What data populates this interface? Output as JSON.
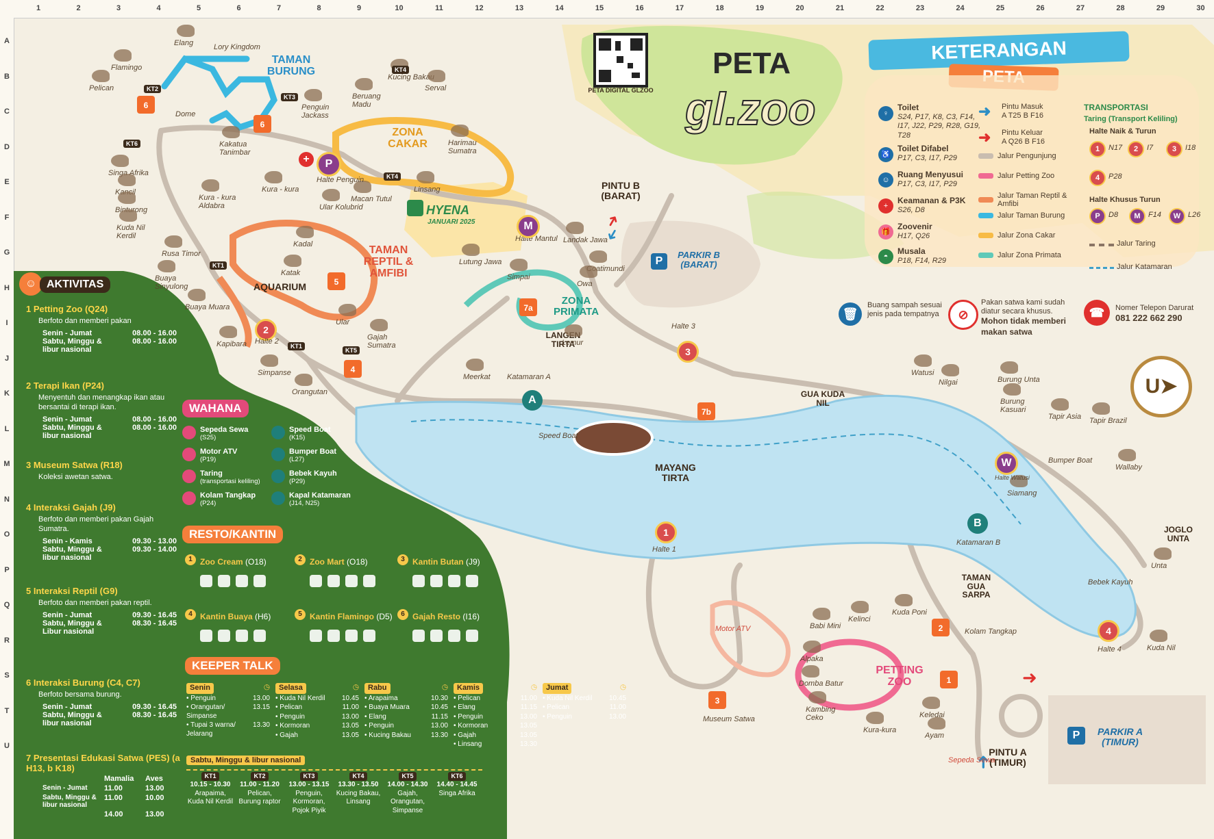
{
  "grid": {
    "columns": [
      "1",
      "2",
      "3",
      "4",
      "5",
      "6",
      "7",
      "8",
      "9",
      "10",
      "11",
      "12",
      "13",
      "14",
      "15",
      "16",
      "17",
      "18",
      "19",
      "20",
      "21",
      "22",
      "23",
      "24",
      "25",
      "26",
      "27",
      "28",
      "29",
      "30"
    ],
    "rows": [
      "A",
      "B",
      "C",
      "D",
      "E",
      "F",
      "G",
      "H",
      "I",
      "J",
      "K",
      "L",
      "M",
      "N",
      "O",
      "P",
      "Q",
      "R",
      "S",
      "T",
      "U"
    ]
  },
  "header": {
    "title_peta": "PETA",
    "logo_text": "gl.zoo",
    "qr_caption": "PETA DIGITAL GLZOO",
    "legend_title_1": "KETERANGAN",
    "legend_title_2": "PETA"
  },
  "legend": {
    "toilet": {
      "title": "Toilet",
      "codes": "S24, P17, K8, C3, F14, I17, J22, P29, R28, G19, T28"
    },
    "toilet_difabel": {
      "title": "Toilet Difabel",
      "codes": "P17, C3, I17, P29"
    },
    "ruang_menyusui": {
      "title": "Ruang Menyusui",
      "codes": "P17, C3, I17, P29"
    },
    "keamanan": {
      "title": "Keamanan & P3K",
      "codes": "S26, D8"
    },
    "zoovenir": {
      "title": "Zoovenir",
      "codes": "H17, Q26"
    },
    "musala": {
      "title": "Musala",
      "codes": "P18, F14, R29"
    },
    "pintu_masuk": {
      "title": "Pintu Masuk",
      "codes": "A T25   B F16"
    },
    "pintu_keluar": {
      "title": "Pintu Keluar",
      "codes": "A Q26   B F16"
    },
    "jalur": [
      "Jalur Pengunjung",
      "Jalur Petting Zoo",
      "Jalur Taman Reptil & Amfibi",
      "Jalur Taman Burung",
      "Jalur Zona Cakar",
      "Jalur Zona Primata"
    ],
    "jalur_colors": [
      "#c9bdb0",
      "#f06a92",
      "#f08a55",
      "#3bb8e0",
      "#f7bb45",
      "#5fc9b8"
    ],
    "transport_title": "TRANSPORTASI",
    "transport_sub": "Taring (Transport Keliling)",
    "halte_naik_turun": "Halte Naik & Turun",
    "halte_naik_list": [
      {
        "n": "1",
        "code": "N17"
      },
      {
        "n": "2",
        "code": "I7"
      },
      {
        "n": "3",
        "code": "I18"
      },
      {
        "n": "4",
        "code": "P28"
      }
    ],
    "halte_khusus_turun": "Halte Khusus Turun",
    "halte_turun_list": [
      {
        "n": "P",
        "code": "D8"
      },
      {
        "n": "M",
        "code": "F14"
      },
      {
        "n": "W",
        "code": "L26"
      }
    ],
    "jalur_taring": "Jalur Taring",
    "jalur_katamaran": "Jalur Katamaran",
    "buang_sampah": "Buang sampah sesuai jenis pada tempatnya",
    "pakan_1": "Pakan satwa kami sudah diatur secara khusus.",
    "pakan_2": "Mohon tidak memberi makan satwa",
    "telepon_label": "Nomer Telepon Darurat",
    "telepon": "081 222 662 290"
  },
  "map": {
    "zones": {
      "taman_burung": "TAMAN BURUNG",
      "zona_cakar": "ZONA CAKAR",
      "taman_reptil": "TAMAN REPTIL & AMFIBI",
      "aquarium": "AQUARIUM",
      "zona_primata": "ZONA PRIMATA",
      "langen_tirta": "LANGEN TIRTA",
      "mayang_tirta": "MAYANG TIRTA",
      "gua_kuda_nil": "GUA KUDA NIL",
      "taman_gua_sarpa": "TAMAN GUA SARPA",
      "petting_zoo": "PETTING ZOO",
      "joglo_unta": "JOGLO UNTA",
      "hyena": "HYENA",
      "hyena_date": "JANUARI 2025",
      "pintu_b": "PINTU B (BARAT)",
      "pintu_a": "PINTU A (TIMUR)",
      "parkir_b": "PARKIR B (BARAT)",
      "parkir_a": "PARKIR A (TIMUR)",
      "lory_kingdom": "Lory Kingdom",
      "dome": "Dome"
    },
    "animals": [
      {
        "name": "Elang"
      },
      {
        "name": "Flamingo"
      },
      {
        "name": "Pelican"
      },
      {
        "name": "Penguin Jackass"
      },
      {
        "name": "Beruang Madu"
      },
      {
        "name": "Kucing Bakau"
      },
      {
        "name": "Serval"
      },
      {
        "name": "Harimau Sumatra"
      },
      {
        "name": "Linsang"
      },
      {
        "name": "Macan Tutul"
      },
      {
        "name": "Kakatua Tanimbar"
      },
      {
        "name": "Singa Afrika"
      },
      {
        "name": "Kancil"
      },
      {
        "name": "Binturong"
      },
      {
        "name": "Kuda Nil Kerdil"
      },
      {
        "name": "Rusa Timor"
      },
      {
        "name": "Buaya Sinyulong"
      },
      {
        "name": "Buaya Muara"
      },
      {
        "name": "Kapibara"
      },
      {
        "name": "Simpanse"
      },
      {
        "name": "Orangutan"
      },
      {
        "name": "Gajah Sumatra"
      },
      {
        "name": "Kura - kura Aldabra"
      },
      {
        "name": "Kura - kura"
      },
      {
        "name": "Ular Kolubrid"
      },
      {
        "name": "Kadal"
      },
      {
        "name": "Katak"
      },
      {
        "name": "Ular"
      },
      {
        "name": "Lutung Jawa"
      },
      {
        "name": "Simpai"
      },
      {
        "name": "Landak Jawa"
      },
      {
        "name": "Coatimundi"
      },
      {
        "name": "Owa"
      },
      {
        "name": "Lemur"
      },
      {
        "name": "Meerkat"
      },
      {
        "name": "Watusi"
      },
      {
        "name": "Nilgai"
      },
      {
        "name": "Burung Unta"
      },
      {
        "name": "Burung Kasuari"
      },
      {
        "name": "Tapir Asia"
      },
      {
        "name": "Tapir Brazil"
      },
      {
        "name": "Wallaby"
      },
      {
        "name": "Siamang"
      },
      {
        "name": "Unta"
      },
      {
        "name": "Kuda Nil"
      },
      {
        "name": "Kelinci"
      },
      {
        "name": "Kuda Poni"
      },
      {
        "name": "Babi Mini"
      },
      {
        "name": "Alpaka"
      },
      {
        "name": "Domba Batur"
      },
      {
        "name": "Kambing Ceko"
      },
      {
        "name": "Kura-kura"
      },
      {
        "name": "Keledai"
      },
      {
        "name": "Ayam"
      }
    ],
    "haltes": {
      "penguin": "Halte Penguin",
      "mantul": "Halte Mantul",
      "h1": "Halte 1",
      "h2": "Halte 2",
      "h3": "Halte 3",
      "h4": "Halte 4",
      "watusi": "Halte Watusi"
    },
    "katamaran_a": "Katamaran A",
    "katamaran_b": "Katamaran B",
    "speed_boat": "Speed Boat",
    "bumper_boat": "Bumper Boat",
    "bebek_kayuh": "Bebek Kayuh",
    "museum_satwa": "Museum Satwa",
    "motor_atv": "Motor ATV",
    "kolam_tangkap": "Kolam Tangkap",
    "sepeda_sewa": "Sepeda Sewa",
    "kt_labels": [
      "KT1",
      "KT2",
      "KT3",
      "KT4",
      "KT5",
      "KT6"
    ],
    "compass": "U"
  },
  "aktivitas": {
    "title": "AKTIVITAS",
    "items": [
      {
        "num": "1",
        "title": "Petting Zoo",
        "code": "(Q24)",
        "desc": "Berfoto dan memberi pakan",
        "rows": [
          [
            "Senin - Jumat",
            "08.00 - 16.00"
          ],
          [
            "Sabtu, Minggu & libur nasional",
            "08.00 - 16.00"
          ]
        ]
      },
      {
        "num": "2",
        "title": "Terapi Ikan",
        "code": "(P24)",
        "desc": "Menyentuh dan menangkap ikan atau bersantai di terapi ikan.",
        "rows": [
          [
            "Senin - Jumat",
            "08.00 - 16.00"
          ],
          [
            "Sabtu, Minggu & libur nasional",
            "08.00 - 16.00"
          ]
        ]
      },
      {
        "num": "3",
        "title": "Museum Satwa",
        "code": "(R18)",
        "desc": "Koleksi awetan satwa.",
        "rows": []
      },
      {
        "num": "4",
        "title": "Interaksi Gajah",
        "code": "(J9)",
        "desc": "Berfoto dan memberi pakan Gajah Sumatra.",
        "rows": [
          [
            "Senin - Kamis",
            "09.30 - 13.00"
          ],
          [
            "Sabtu, Minggu & libur nasional",
            "09.30 - 14.00"
          ]
        ]
      },
      {
        "num": "5",
        "title": "Interaksi Reptil",
        "code": "(G9)",
        "desc": "Berfoto dan memberi pakan reptil.",
        "rows": [
          [
            "Senin - Jumat",
            "09.30 - 16.45"
          ],
          [
            "Sabtu, Minggu & Libur nasional",
            "08.30 - 16.45"
          ]
        ]
      },
      {
        "num": "6",
        "title": "Interaksi Burung",
        "code": "(C4, C7)",
        "desc": "Berfoto bersama burung.",
        "rows": [
          [
            "Senin - Jumat",
            "09.30 - 16.45"
          ],
          [
            "Sabtu, Minggu & libur nasional",
            "08.30 - 16.45"
          ]
        ]
      },
      {
        "num": "7",
        "title": "Presentasi Edukasi Satwa (PES)",
        "code": "(a H13, b K18)",
        "desc": "",
        "rows": []
      }
    ],
    "pes_col_a": "Mamalia",
    "pes_col_b": "Aves",
    "pes_rows": [
      [
        "Senin - Jumat",
        "11.00",
        "13.00"
      ],
      [
        "Sabtu, Minggu & libur nasional",
        "11.00",
        "10.00"
      ],
      [
        "",
        "14.00",
        "13.00"
      ]
    ]
  },
  "wahana": {
    "title": "WAHANA",
    "items": [
      {
        "name": "Sepeda Sewa",
        "code": "(S25)"
      },
      {
        "name": "Motor ATV",
        "code": "(P19)"
      },
      {
        "name": "Taring",
        "code": "(transportasi keliling)"
      },
      {
        "name": "Kolam Tangkap",
        "code": "(P24)"
      },
      {
        "name": "Speed Boat",
        "code": "(K15)"
      },
      {
        "name": "Bumper Boat",
        "code": "(L27)"
      },
      {
        "name": "Bebek Kayuh",
        "code": "(P29)"
      },
      {
        "name": "Kapal Katamaran",
        "code": "(J14, N25)"
      }
    ]
  },
  "resto": {
    "title": "RESTO/KANTIN",
    "items": [
      {
        "name": "Zoo Cream",
        "code": "(O18)"
      },
      {
        "name": "Zoo Mart",
        "code": "(O18)"
      },
      {
        "name": "Kantin Butan",
        "code": "(J9)"
      },
      {
        "name": "Kantin Buaya",
        "code": "(H6)"
      },
      {
        "name": "Kantin Flamingo",
        "code": "(D5)"
      },
      {
        "name": "Gajah Resto",
        "code": "(I16)"
      }
    ]
  },
  "keeper_talk": {
    "title": "KEEPER TALK",
    "days": [
      {
        "day": "Senin",
        "items": [
          [
            "Penguin",
            "13.00"
          ],
          [
            "Orangutan/ Simpanse",
            "13.15"
          ],
          [
            "Tupai 3 warna/ Jelarang",
            "13.30"
          ]
        ]
      },
      {
        "day": "Selasa",
        "items": [
          [
            "Kuda Nil Kerdil",
            "10.45"
          ],
          [
            "Pelican",
            "11.00"
          ],
          [
            "Penguin",
            "13.00"
          ],
          [
            "Kormoran",
            "13.05"
          ],
          [
            "Gajah",
            "13.05"
          ]
        ]
      },
      {
        "day": "Rabu",
        "items": [
          [
            "Arapaima",
            "10.30"
          ],
          [
            "Buaya Muara",
            "10.45"
          ],
          [
            "Elang",
            "11.15"
          ],
          [
            "Penguin",
            "13.00"
          ],
          [
            "Kucing Bakau",
            "13.30"
          ]
        ]
      },
      {
        "day": "Kamis",
        "items": [
          [
            "Pelican",
            "11.00"
          ],
          [
            "Elang",
            "11.15"
          ],
          [
            "Penguin",
            "13.00"
          ],
          [
            "Kormoran",
            "13.05"
          ],
          [
            "Gajah",
            "13.05"
          ],
          [
            "Linsang",
            "13.30"
          ]
        ]
      },
      {
        "day": "Jumat",
        "items": [
          [
            "Kuda Nil Kerdil",
            "10.45"
          ],
          [
            "Pelican",
            "11.00"
          ],
          [
            "Penguin",
            "13.00"
          ]
        ]
      }
    ],
    "weekend_title": "Sabtu, Minggu & libur nasional",
    "weekend": [
      {
        "kt": "KT1",
        "time": "10.15 - 10.30",
        "animals": "Arapaima, Kuda Nil Kerdil"
      },
      {
        "kt": "KT2",
        "time": "11.00 - 11.20",
        "animals": "Pelican, Burung raptor"
      },
      {
        "kt": "KT3",
        "time": "13.00 - 13.15",
        "animals": "Penguin, Kormoran, Pojok Piyik"
      },
      {
        "kt": "KT4",
        "time": "13.30 - 13.50",
        "animals": "Kucing Bakau, Linsang"
      },
      {
        "kt": "KT5",
        "time": "14.00 - 14.30",
        "animals": "Gajah, Orangutan, Simpanse"
      },
      {
        "kt": "KT6",
        "time": "14.40 - 14.45",
        "animals": "Singa Afrika"
      }
    ]
  }
}
